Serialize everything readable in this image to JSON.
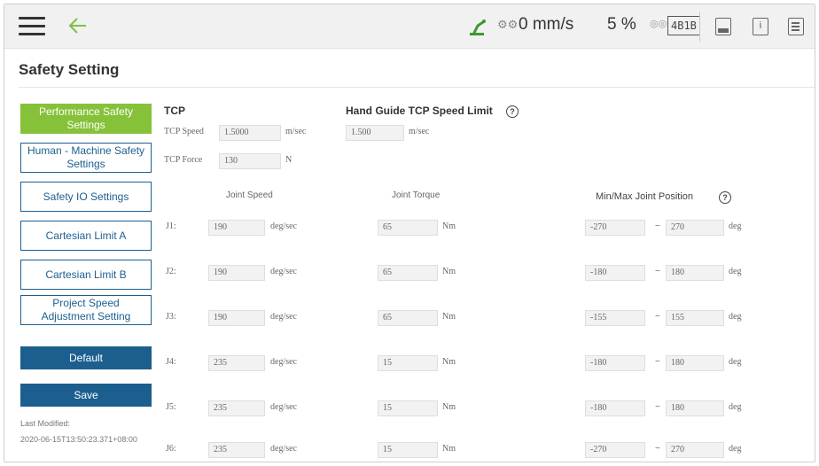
{
  "topbar": {
    "speed_value": "0 mm/s",
    "speed_percent": "5 %",
    "badge": "4B1B"
  },
  "page": {
    "title": "Safety Setting"
  },
  "menu": {
    "items": [
      {
        "label": "Performance Safety Settings",
        "active": true
      },
      {
        "label": "Human - Machine Safety Settings",
        "active": false
      },
      {
        "label": "Safety IO Settings",
        "active": false
      },
      {
        "label": "Cartesian Limit A",
        "active": false
      },
      {
        "label": "Cartesian Limit B",
        "active": false
      },
      {
        "label": "Project Speed Adjustment Setting",
        "active": false
      }
    ],
    "default_label": "Default",
    "save_label": "Save",
    "last_modified_label": "Last Modified:",
    "last_modified_value": "2020-06-15T13:50:23.371+08:00"
  },
  "tcp": {
    "title": "TCP",
    "speed_label": "TCP Speed",
    "speed_value": "1.5000",
    "speed_unit": "m/sec",
    "force_label": "TCP Force",
    "force_value": "130",
    "force_unit": "N"
  },
  "hand_guide": {
    "title": "Hand Guide TCP Speed Limit",
    "value": "1.500",
    "unit": "m/sec"
  },
  "joints": {
    "speed_header": "Joint Speed",
    "torque_header": "Joint Torque",
    "position_header": "Min/Max Joint Position",
    "speed_unit": "deg/sec",
    "torque_unit": "Nm",
    "position_unit": "deg",
    "separator": "~",
    "rows": [
      {
        "label": "J1:",
        "speed": "190",
        "torque": "65",
        "min": "-270",
        "max": "270"
      },
      {
        "label": "J2:",
        "speed": "190",
        "torque": "65",
        "min": "-180",
        "max": "180"
      },
      {
        "label": "J3:",
        "speed": "190",
        "torque": "65",
        "min": "-155",
        "max": "155"
      },
      {
        "label": "J4:",
        "speed": "235",
        "torque": "15",
        "min": "-180",
        "max": "180"
      },
      {
        "label": "J5:",
        "speed": "235",
        "torque": "15",
        "min": "-180",
        "max": "180"
      },
      {
        "label": "J6:",
        "speed": "235",
        "torque": "15",
        "min": "-270",
        "max": "270"
      }
    ]
  },
  "colors": {
    "active_green": "#86c13a",
    "primary_blue": "#1c5f8e",
    "back_arrow_green": "#7dc142"
  }
}
